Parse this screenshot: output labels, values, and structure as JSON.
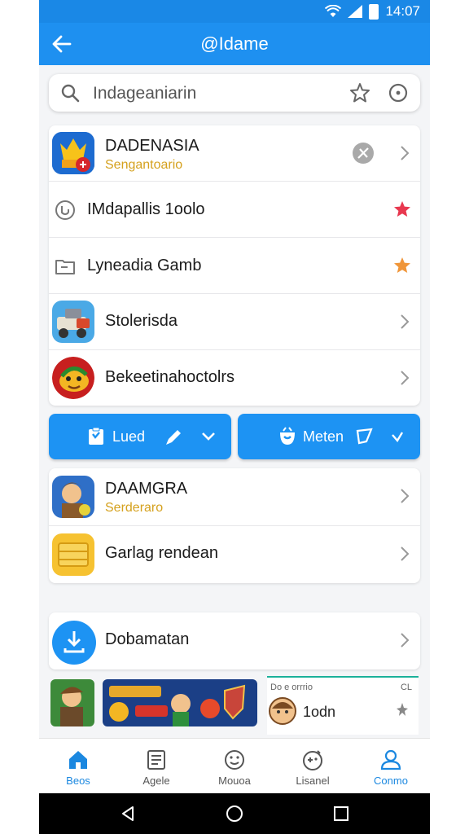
{
  "status_bar": {
    "time": "14:07"
  },
  "app_bar": {
    "title": "@Idame"
  },
  "search": {
    "placeholder": "Indageaniarin"
  },
  "list1": [
    {
      "title": "DADENASIA",
      "subtitle": "Sengantoario"
    },
    {
      "title": "IMdapallis 1oolo"
    },
    {
      "title": "Lyneadia Gamb"
    },
    {
      "title": "Stolerisda"
    },
    {
      "title": "Bekeetinahoctolrs"
    }
  ],
  "buttons": {
    "left_label": "Lued",
    "right_label": "Meten"
  },
  "list2": [
    {
      "title": "DAAMGRA",
      "subtitle": "Serderaro"
    },
    {
      "title": "Garlag rendean"
    }
  ],
  "list3": [
    {
      "title": "Dobamatan"
    }
  ],
  "banner": {
    "right_top": "Do e orrrio",
    "right_tag": "CL",
    "right_name": "1odn"
  },
  "bottom_nav": [
    {
      "label": "Beos"
    },
    {
      "label": "Agele"
    },
    {
      "label": "Mouoa"
    },
    {
      "label": "Lisanel"
    },
    {
      "label": "Conmo"
    }
  ],
  "colors": {
    "primary": "#1e90f0",
    "star_red": "#e8384f",
    "star_orange": "#f0963a",
    "subtitle_gold": "#d5a11e"
  }
}
